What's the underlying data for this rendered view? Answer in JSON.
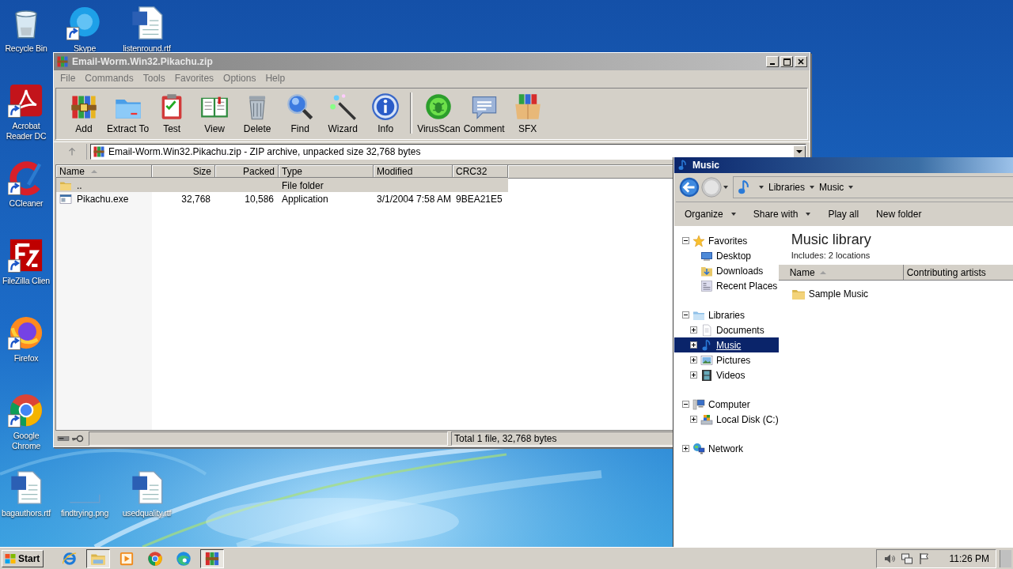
{
  "desktop": {
    "icons": [
      {
        "label": "Recycle Bin",
        "kind": "recycle",
        "shortcut": false
      },
      {
        "label": "Skype",
        "kind": "skype",
        "shortcut": true
      },
      {
        "label": "listenround.rtf",
        "kind": "word",
        "shortcut": false
      },
      {
        "label": "Acrobat Reader DC",
        "kind": "acrobat",
        "shortcut": true
      },
      {
        "label": "CCleaner",
        "kind": "ccleaner",
        "shortcut": true
      },
      {
        "label": "FileZilla Clien",
        "kind": "filezilla",
        "shortcut": true
      },
      {
        "label": "Firefox",
        "kind": "firefox",
        "shortcut": true
      },
      {
        "label": "Google Chrome",
        "kind": "chrome",
        "shortcut": true
      },
      {
        "label": "bagauthors.rtf",
        "kind": "word",
        "shortcut": false
      },
      {
        "label": "findtrying.png",
        "kind": "blank",
        "shortcut": false
      },
      {
        "label": "usedquality.rtf",
        "kind": "word",
        "shortcut": false
      }
    ]
  },
  "archiver": {
    "title": "Email-Worm.Win32.Pikachu.zip",
    "menu": [
      "File",
      "Commands",
      "Tools",
      "Favorites",
      "Options",
      "Help"
    ],
    "toolbar": [
      {
        "label": "Add",
        "kind": "add"
      },
      {
        "label": "Extract To",
        "kind": "extract"
      },
      {
        "label": "Test",
        "kind": "test"
      },
      {
        "label": "View",
        "kind": "view"
      },
      {
        "label": "Delete",
        "kind": "delete"
      },
      {
        "label": "Find",
        "kind": "find"
      },
      {
        "label": "Wizard",
        "kind": "wizard"
      },
      {
        "label": "Info",
        "kind": "info"
      },
      {
        "label": "VirusScan",
        "kind": "virusscan"
      },
      {
        "label": "Comment",
        "kind": "comment"
      },
      {
        "label": "SFX",
        "kind": "sfx"
      }
    ],
    "address": "Email-Worm.Win32.Pikachu.zip - ZIP archive, unpacked size 32,768 bytes",
    "columns": [
      {
        "label": "Name",
        "sorted": true
      },
      {
        "label": "Size",
        "sorted": false
      },
      {
        "label": "Packed",
        "sorted": false
      },
      {
        "label": "Type",
        "sorted": false
      },
      {
        "label": "Modified",
        "sorted": false
      },
      {
        "label": "CRC32",
        "sorted": false
      }
    ],
    "rows": [
      {
        "kind": "folder",
        "selected": true,
        "name": "..",
        "type": "File folder"
      },
      {
        "kind": "exe",
        "selected": false,
        "name": "Pikachu.exe",
        "size": "32,768",
        "packed": "10,586",
        "type": "Application",
        "modified": "3/1/2004 7:58 AM",
        "crc32": "9BEA21E5"
      }
    ],
    "status": "Total 1 file, 32,768 bytes"
  },
  "explorer": {
    "title": "Music",
    "breadcrumb": [
      "Libraries",
      "Music"
    ],
    "commands": [
      {
        "label": "Organize",
        "dropdown": true
      },
      {
        "label": "Share with",
        "dropdown": true
      },
      {
        "label": "Play all",
        "dropdown": false
      },
      {
        "label": "New folder",
        "dropdown": false
      }
    ],
    "nav": [
      {
        "label": "Favorites",
        "kind": "star",
        "toggle": true,
        "expanded": true,
        "selected": false,
        "children": [
          {
            "label": "Desktop",
            "kind": "desktop",
            "toggle": false,
            "selected": false
          },
          {
            "label": "Downloads",
            "kind": "downloads",
            "toggle": false,
            "selected": false
          },
          {
            "label": "Recent Places",
            "kind": "recent",
            "toggle": false,
            "selected": false
          }
        ]
      },
      {
        "label": "Libraries",
        "kind": "libraries",
        "toggle": true,
        "expanded": true,
        "selected": false,
        "children": [
          {
            "label": "Documents",
            "kind": "documents",
            "toggle": true,
            "expanded": false,
            "selected": false
          },
          {
            "label": "Music",
            "kind": "music",
            "toggle": true,
            "expanded": false,
            "selected": true
          },
          {
            "label": "Pictures",
            "kind": "pictures",
            "toggle": true,
            "expanded": false,
            "selected": false
          },
          {
            "label": "Videos",
            "kind": "videos",
            "toggle": true,
            "expanded": false,
            "selected": false
          }
        ]
      },
      {
        "label": "Computer",
        "kind": "computer",
        "toggle": true,
        "expanded": true,
        "selected": false,
        "children": [
          {
            "label": "Local Disk (C:)",
            "kind": "disk",
            "toggle": true,
            "expanded": false,
            "selected": false
          }
        ]
      },
      {
        "label": "Network",
        "kind": "network",
        "toggle": true,
        "expanded": false,
        "selected": false
      }
    ],
    "heading": "Music library",
    "subheading": "Includes:  2 locations",
    "columns": [
      {
        "label": "Name",
        "sorted": true
      },
      {
        "label": "Contributing artists",
        "sorted": false
      }
    ],
    "items": [
      {
        "label": "Sample Music",
        "kind": "folder"
      }
    ]
  },
  "taskbar": {
    "start": "Start",
    "apps": [
      {
        "kind": "ie",
        "active": false
      },
      {
        "kind": "explorer",
        "active": true
      },
      {
        "kind": "media",
        "active": false
      },
      {
        "kind": "chrome",
        "active": false
      },
      {
        "kind": "edge",
        "active": false
      },
      {
        "kind": "archiver",
        "active": true
      }
    ],
    "time": "11:26 PM"
  }
}
